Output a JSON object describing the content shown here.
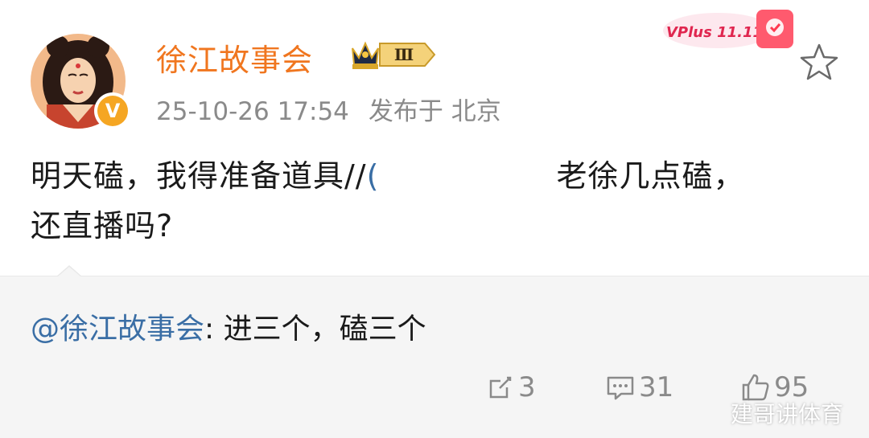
{
  "post": {
    "author": "徐江故事会",
    "level_badge": "Ⅲ",
    "verified_badge": "V",
    "date_time": "25-10-26 17:54",
    "location_label": "发布于 北京",
    "text_part1": "明天磕，我得准备道具//",
    "text_fragment": "(",
    "text_part2": "老徐几点磕，",
    "text_line2": "还直播吗?"
  },
  "promo": {
    "label": "VPlus 11.11"
  },
  "quote": {
    "mention": "@徐江故事会",
    "text": ": 进三个，磕三个"
  },
  "actions": {
    "reposts": "3",
    "comments": "31",
    "likes": "95"
  },
  "watermark": "建哥讲体育",
  "colors": {
    "username": "#f0761f",
    "mention": "#3a6ea5",
    "meta": "#8a8a8a",
    "badge_gold": "#f5a623"
  },
  "icons": [
    "avatar",
    "crown-level-icon",
    "verified-v-icon",
    "star-icon",
    "repost-icon",
    "comment-icon",
    "like-icon"
  ]
}
